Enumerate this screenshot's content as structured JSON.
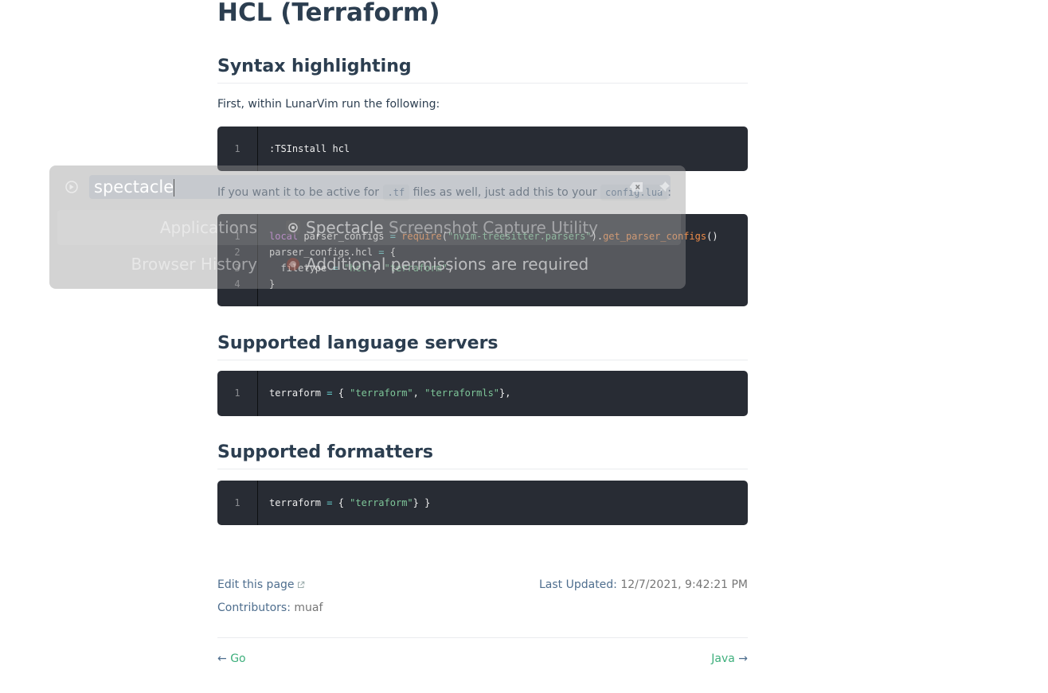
{
  "page": {
    "title": "HCL (Terraform)",
    "sections": {
      "syntax": "Syntax highlighting",
      "servers": "Supported language servers",
      "formatters": "Supported formatters"
    },
    "intro_text": "First, within LunarVim run the following:",
    "tf_text_before": "If you want it to be active for ",
    "tf_code": ".tf",
    "tf_text_mid": " files as well, just add this to your ",
    "tf_code2": "config.lua",
    "tf_text_after": ":"
  },
  "code": {
    "block1": {
      "line_numbers": [
        "1"
      ],
      "line1": ":TSInstall hcl"
    },
    "block2": {
      "line_numbers": [
        "1",
        "2",
        "3",
        "4"
      ],
      "l1_kw": "local",
      "l1_a": " parser_configs ",
      "l1_eq": "=",
      "l1_req": " require",
      "l1_p": "(",
      "l1_str": "\"nvim-treesitter.parsers\"",
      "l1_p2": ").",
      "l1_fn": "get_parser_configs",
      "l1_end": "()",
      "l2_a": "parser_configs.hcl ",
      "l2_eq": "=",
      "l2_b": " {",
      "l3_a": "  filetype ",
      "l3_eq": "=",
      "l3_s1": " \"hcl\"",
      "l3_c": ", ",
      "l3_s2": "\"terraform\"",
      "l3_e": ",",
      "l4": "}"
    },
    "block3": {
      "line_numbers": [
        "1"
      ],
      "a": "terraform ",
      "eq": "=",
      "b": " { ",
      "s1": "\"terraform\"",
      "c": ", ",
      "s2": "\"terraformls\"",
      "e": "},"
    },
    "block4": {
      "line_numbers": [
        "1"
      ],
      "a": "terraform ",
      "eq": "=",
      "b": " { ",
      "s1": "\"terraform\"",
      "e": "} }"
    }
  },
  "footer": {
    "edit_link": "Edit this page",
    "last_updated_label": "Last Updated:",
    "last_updated_value": "12/7/2021, 9:42:21 PM",
    "contributors_label": "Contributors:",
    "contributors_value": "muaf",
    "prev_arrow": "←",
    "prev": "Go",
    "next": "Java",
    "next_arrow": "→"
  },
  "krunner": {
    "query": "spectacle",
    "results": [
      {
        "category": "Applications",
        "title": "Spectacle",
        "subtitle": "Screenshot Capture Utility"
      },
      {
        "category": "Browser History",
        "title": "Additional permissions are required",
        "subtitle": ""
      }
    ]
  },
  "colors": {
    "code_bg": "#282c34",
    "accent_green": "#3eaf7c",
    "heading": "#2c3e50"
  }
}
